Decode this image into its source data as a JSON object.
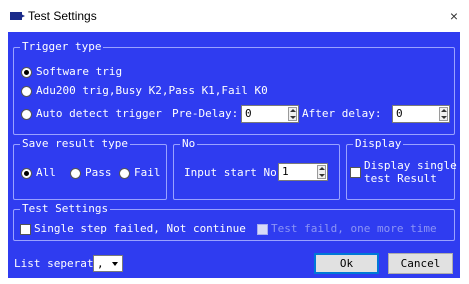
{
  "window": {
    "title": "Test Settings",
    "close_glyph": "×",
    "icon": "app-icon"
  },
  "trigger": {
    "legend": "Trigger type",
    "opt_software": "Software trig",
    "opt_adu": "Adu200 trig,Busy K2,Pass K1,Fail K0",
    "opt_auto": "Auto detect trigger",
    "selected": "Software trig",
    "pre_delay_label": "Pre-Delay:",
    "pre_delay_value": "0",
    "after_delay_label": "After delay:",
    "after_delay_value": "0"
  },
  "save_result": {
    "legend": "Save result type",
    "opt_all": "All",
    "opt_pass": "Pass",
    "opt_fail": "Fail",
    "selected": "All"
  },
  "no": {
    "legend": "No",
    "input_label": "Input start No",
    "input_value": "1"
  },
  "display": {
    "legend": "Display",
    "line1": "Display single",
    "line2": "test Result",
    "checked": false
  },
  "test_settings": {
    "legend": "Test Settings",
    "single_step_label": "Single step failed, Not continue",
    "single_step_checked": false,
    "retry_label": "Test faild, one more time",
    "retry_enabled": false
  },
  "footer": {
    "separator_label": "List seperator:",
    "separator_value": ",",
    "ok_label": "Ok",
    "cancel_label": "Cancel"
  },
  "colors": {
    "background": "#2f3cf0",
    "group_border": "#9aa2ff",
    "text": "#ffffff",
    "disabled_text": "#8d95f5"
  }
}
